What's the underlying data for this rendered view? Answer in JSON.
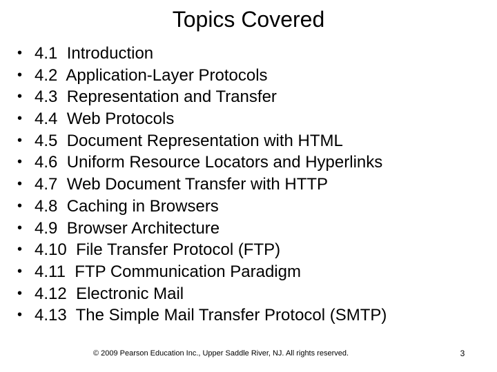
{
  "slide": {
    "title": "Topics Covered",
    "background_color": "#ffffff",
    "text_color": "#000000",
    "bullet_glyph": "•",
    "topics": [
      {
        "number": "4.1",
        "label": "Introduction"
      },
      {
        "number": "4.2",
        "label": "Application-Layer Protocols"
      },
      {
        "number": "4.3",
        "label": "Representation and Transfer"
      },
      {
        "number": "4.4",
        "label": "Web Protocols"
      },
      {
        "number": "4.5",
        "label": "Document Representation with HTML"
      },
      {
        "number": "4.6",
        "label": "Uniform Resource Locators and Hyperlinks"
      },
      {
        "number": "4.7",
        "label": "Web Document Transfer with HTTP"
      },
      {
        "number": "4.8",
        "label": "Caching in Browsers"
      },
      {
        "number": "4.9",
        "label": "Browser Architecture"
      },
      {
        "number": "4.10",
        "label": "File Transfer Protocol (FTP)"
      },
      {
        "number": "4.11",
        "label": "FTP Communication Paradigm"
      },
      {
        "number": "4.12",
        "label": "Electronic Mail"
      },
      {
        "number": "4.13",
        "label": "The Simple Mail Transfer Protocol (SMTP)"
      }
    ],
    "footer": {
      "copyright": "© 2009 Pearson Education Inc., Upper Saddle River, NJ. All rights reserved.",
      "page_number": "3"
    }
  }
}
